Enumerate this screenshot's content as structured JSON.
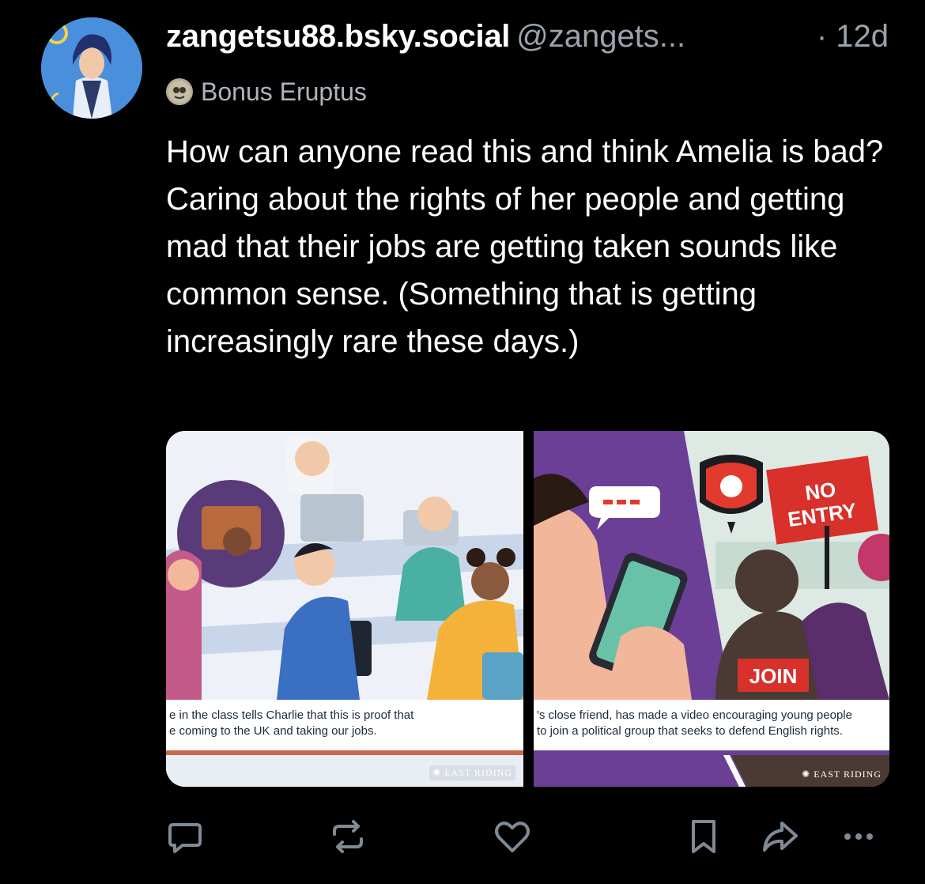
{
  "post": {
    "author_display": "zangetsu88.bsky.social",
    "handle": "@zangets...",
    "time": "· 12d",
    "context_label": "Bonus Eruptus",
    "text": "How can anyone read this and think Amelia is bad? Caring about the rights of her people and getting mad that their jobs are getting taken sounds like common sense. (Something that is getting increasingly rare these days.)"
  },
  "images": [
    {
      "caption_line1": "e in the class tells Charlie that this is proof that",
      "caption_line2": "e coming to the UK and taking our jobs.",
      "watermark": "EAST RIDING"
    },
    {
      "caption_line1": "'s close friend, has made a video encouraging young people",
      "caption_line2": "to join a political group that seeks to defend English rights.",
      "watermark": "EAST RIDING",
      "sign_text_1": "NO",
      "sign_text_2": "ENTRY",
      "join_sign": "JOIN"
    }
  ],
  "actions": [
    "reply-icon",
    "repost-icon",
    "like-icon",
    "bookmark-icon",
    "share-icon",
    "more-icon"
  ],
  "colors": {
    "background": "#000000",
    "secondary_text": "#9aa3ad",
    "icon": "#7f8a96"
  }
}
